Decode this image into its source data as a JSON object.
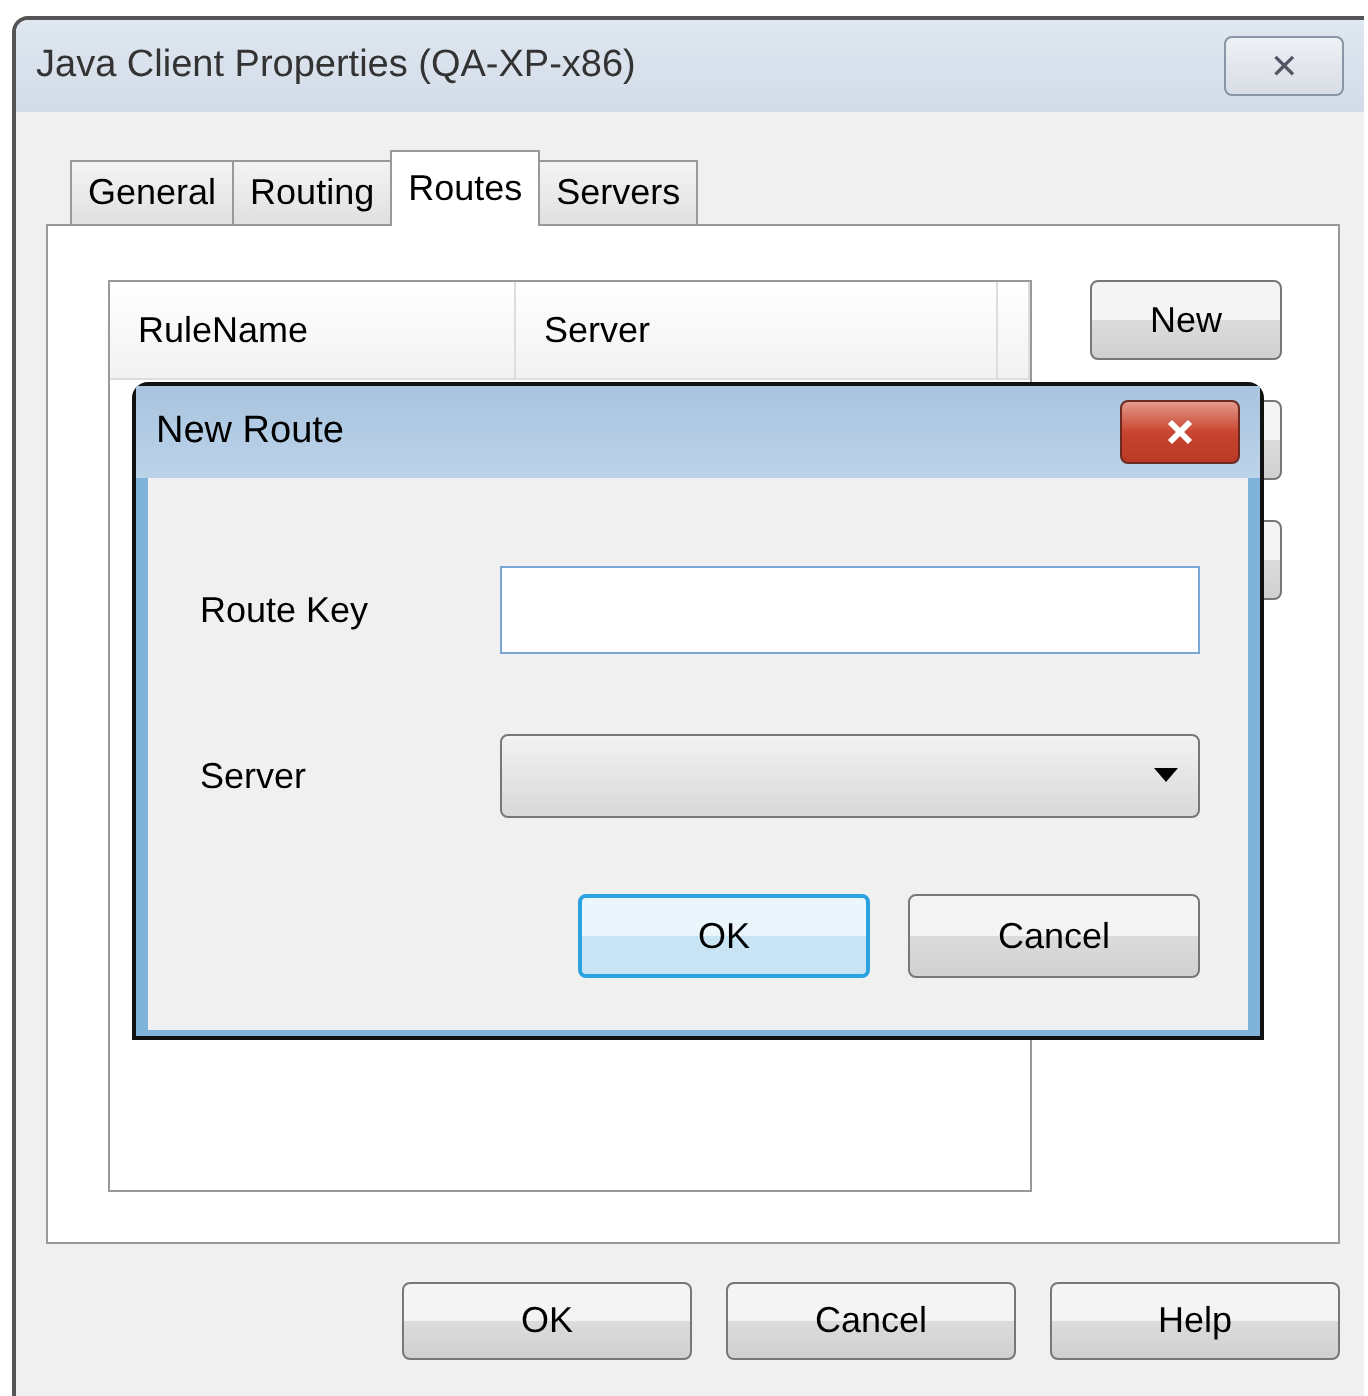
{
  "window": {
    "title": "Java Client Properties (QA-XP-x86)",
    "close_icon": "✕"
  },
  "tabs": [
    {
      "label": "General",
      "selected": false
    },
    {
      "label": "Routing",
      "selected": false
    },
    {
      "label": "Routes",
      "selected": true
    },
    {
      "label": "Servers",
      "selected": false
    }
  ],
  "table": {
    "columns": [
      "RuleName",
      "Server"
    ]
  },
  "side_buttons": [
    "New"
  ],
  "dialog": {
    "title": "New Route",
    "fields": [
      {
        "kind": "text",
        "label": "Route Key"
      },
      {
        "kind": "dropdown",
        "label": "Server"
      }
    ],
    "buttons": [
      {
        "label": "OK",
        "default": true
      },
      {
        "label": "Cancel",
        "default": false
      }
    ]
  },
  "buttons": [
    "OK",
    "Cancel",
    "Help"
  ]
}
